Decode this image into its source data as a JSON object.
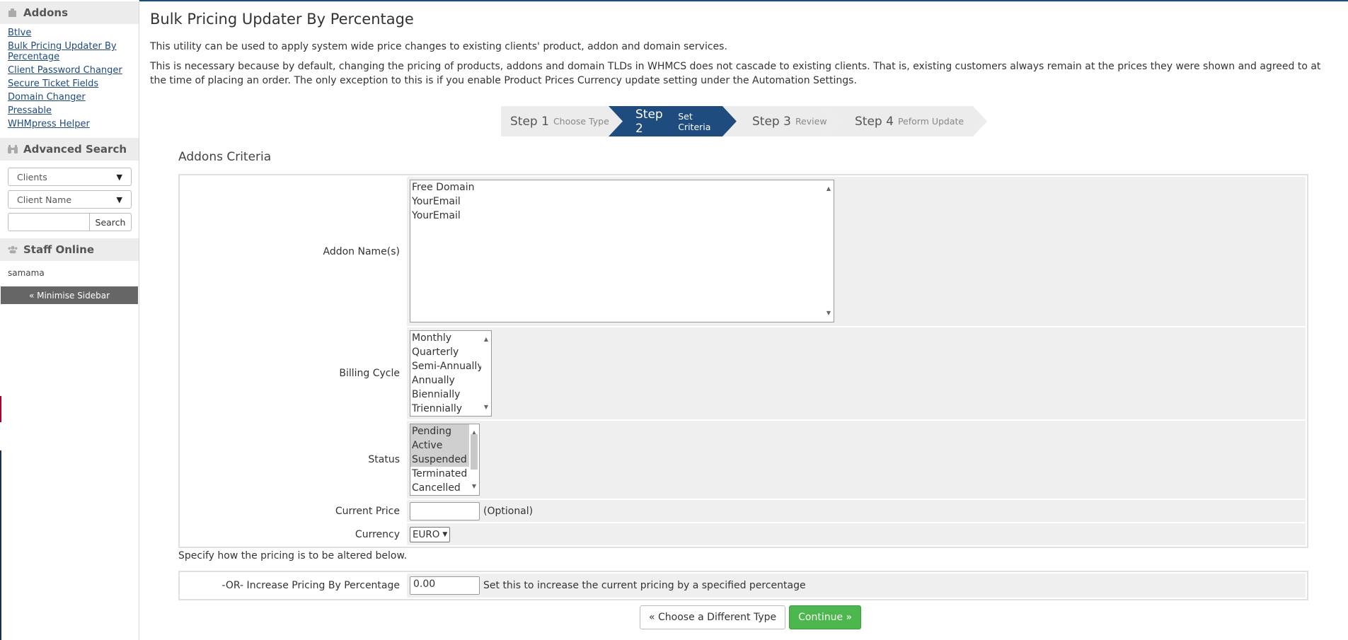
{
  "sidebar": {
    "addons_title": "Addons",
    "addon_links": [
      "Btlve",
      "Bulk Pricing Updater By Percentage",
      "Client Password Changer",
      "Secure Ticket Fields",
      "Domain Changer",
      "Pressable",
      "WHMpress Helper"
    ],
    "advanced_search_title": "Advanced Search",
    "search_type": "Clients",
    "search_field": "Client Name",
    "search_value": "",
    "search_button": "Search",
    "staff_online_title": "Staff Online",
    "staff_name": "samama",
    "minimise_label": "« Minimise Sidebar"
  },
  "page": {
    "title": "Bulk Pricing Updater By Percentage",
    "intro1": "This utility can be used to apply system wide price changes to existing clients' product, addon and domain services.",
    "intro2": "This is necessary because by default, changing the pricing of products, addons and domain TLDs in WHMCS does not cascade to existing clients. That is, existing customers always remain at the prices they were shown and agreed to at the time of placing an order. The only exception to this is if you enable Product Prices Currency update setting under the Automation Settings."
  },
  "steps": [
    {
      "num": "Step 1",
      "label": "Choose Type",
      "active": false
    },
    {
      "num": "Step 2",
      "label": "Set Criteria",
      "active": true
    },
    {
      "num": "Step 3",
      "label": "Review",
      "active": false
    },
    {
      "num": "Step 4",
      "label": "Peform Update",
      "active": false
    }
  ],
  "criteria": {
    "title": "Addons Criteria",
    "addon_name_label": "Addon Name(s)",
    "addon_options": [
      "Free Domain",
      "YourEmail",
      "YourEmail"
    ],
    "billing_cycle_label": "Billing Cycle",
    "billing_options": [
      "Monthly",
      "Quarterly",
      "Semi-Annually",
      "Annually",
      "Biennially",
      "Triennially"
    ],
    "status_label": "Status",
    "status_options": [
      "Pending",
      "Active",
      "Suspended",
      "Terminated",
      "Cancelled"
    ],
    "status_selected": [
      "Pending",
      "Active",
      "Suspended"
    ],
    "current_price_label": "Current Price",
    "current_price_value": "",
    "current_price_note": "(Optional)",
    "currency_label": "Currency",
    "currency_value": "EURO"
  },
  "alter": {
    "specify_text": "Specify how the pricing is to be altered below.",
    "increase_label": "-OR- Increase Pricing By Percentage",
    "increase_value": "0.00",
    "increase_note": "Set this to increase the current pricing by a specified percentage"
  },
  "buttons": {
    "back_label": "« Choose a Different Type",
    "continue_label": "Continue »"
  },
  "colors": {
    "active_step": "#1e4c7e",
    "continue_button": "#4cb74c",
    "link": "#1d4a82"
  }
}
